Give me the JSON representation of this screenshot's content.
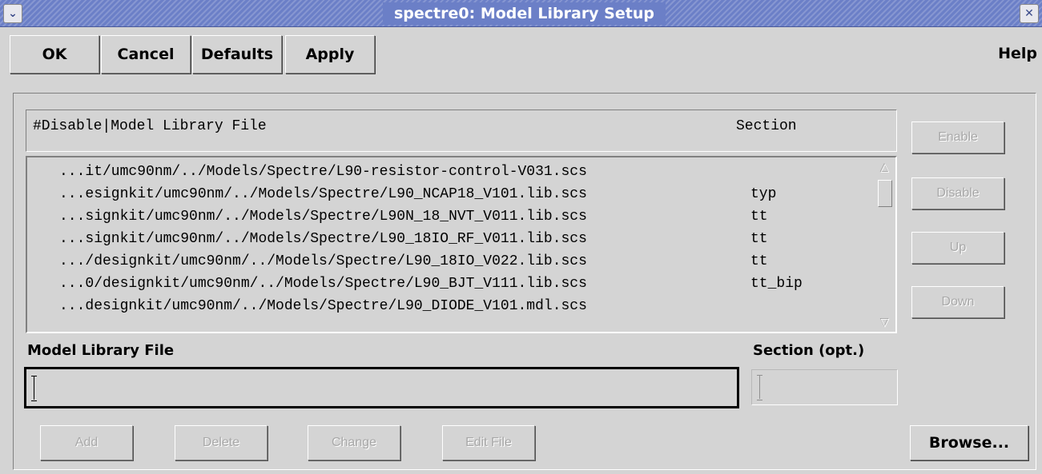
{
  "window": {
    "title": "spectre0: Model Library Setup",
    "menu_icon": "chevron-down-icon",
    "close_icon": "close-icon",
    "menu_glyph": "⌄",
    "close_glyph": "✕"
  },
  "toolbar": {
    "ok_label": "OK",
    "cancel_label": "Cancel",
    "defaults_label": "Defaults",
    "apply_label": "Apply",
    "help_label": "Help"
  },
  "list": {
    "header_file": "#Disable|Model Library File",
    "header_section": "Section",
    "rows": [
      {
        "file": "...it/umc90nm/../Models/Spectre/L90-resistor-control-V031.scs",
        "section": ""
      },
      {
        "file": "...esignkit/umc90nm/../Models/Spectre/L90_NCAP18_V101.lib.scs",
        "section": "typ"
      },
      {
        "file": "...signkit/umc90nm/../Models/Spectre/L90N_18_NVT_V011.lib.scs",
        "section": "tt"
      },
      {
        "file": "...signkit/umc90nm/../Models/Spectre/L90_18IO_RF_V011.lib.scs",
        "section": "tt"
      },
      {
        "file": ".../designkit/umc90nm/../Models/Spectre/L90_18IO_V022.lib.scs",
        "section": "tt"
      },
      {
        "file": "...0/designkit/umc90nm/../Models/Spectre/L90_BJT_V111.lib.scs",
        "section": "tt_bip"
      },
      {
        "file": "...designkit/umc90nm/../Models/Spectre/L90_DIODE_V101.mdl.scs",
        "section": ""
      }
    ]
  },
  "side_buttons": {
    "enable_label": "Enable",
    "disable_label": "Disable",
    "up_label": "Up",
    "down_label": "Down"
  },
  "form": {
    "file_label": "Model Library File",
    "file_value": "",
    "section_label": "Section (opt.)",
    "section_value": ""
  },
  "bottom_buttons": {
    "add_label": "Add",
    "delete_label": "Delete",
    "change_label": "Change",
    "edit_file_label": "Edit File",
    "browse_label": "Browse..."
  }
}
